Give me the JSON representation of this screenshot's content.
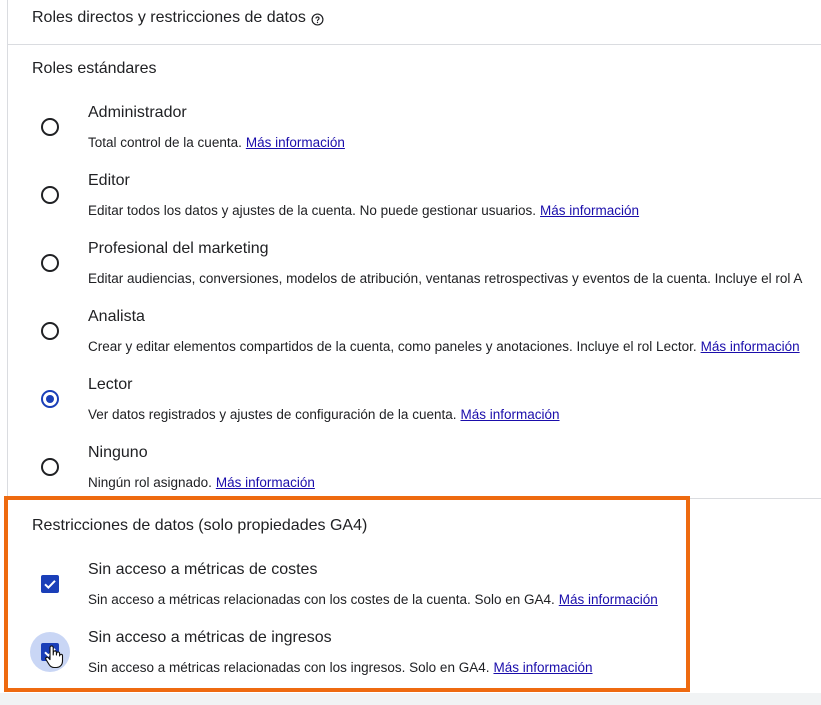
{
  "header": {
    "title": "Roles directos y restricciones de datos",
    "help_icon": "help-circle-icon"
  },
  "standard_roles": {
    "title": "Roles estándares",
    "options": [
      {
        "label": "Administrador",
        "description": "Total control de la cuenta.",
        "link": "Más información",
        "selected": false
      },
      {
        "label": "Editor",
        "description": "Editar todos los datos y ajustes de la cuenta. No puede gestionar usuarios.",
        "link": "Más información",
        "selected": false
      },
      {
        "label": "Profesional del marketing",
        "description": "Editar audiencias, conversiones, modelos de atribución, ventanas retrospectivas y eventos de la cuenta. Incluye el rol A",
        "link": "",
        "selected": false
      },
      {
        "label": "Analista",
        "description": "Crear y editar elementos compartidos de la cuenta, como paneles y anotaciones. Incluye el rol Lector.",
        "link": "Más información",
        "selected": false
      },
      {
        "label": "Lector",
        "description": "Ver datos registrados y ajustes de configuración de la cuenta.",
        "link": "Más información",
        "selected": true
      },
      {
        "label": "Ninguno",
        "description": "Ningún rol asignado.",
        "link": "Más información",
        "selected": false
      }
    ]
  },
  "data_restrictions": {
    "title": "Restricciones de datos (solo propiedades GA4)",
    "options": [
      {
        "label": "Sin acceso a métricas de costes",
        "description": "Sin acceso a métricas relacionadas con los costes de la cuenta. Solo en GA4.",
        "link": "Más información",
        "checked": true
      },
      {
        "label": "Sin acceso a métricas de ingresos",
        "description": "Sin acceso a métricas relacionadas con los ingresos. Solo en GA4.",
        "link": "Más información",
        "checked": true
      }
    ]
  },
  "colors": {
    "accent": "#1a3fb8",
    "highlight": "#ee6a10",
    "link": "#1a0dab"
  }
}
